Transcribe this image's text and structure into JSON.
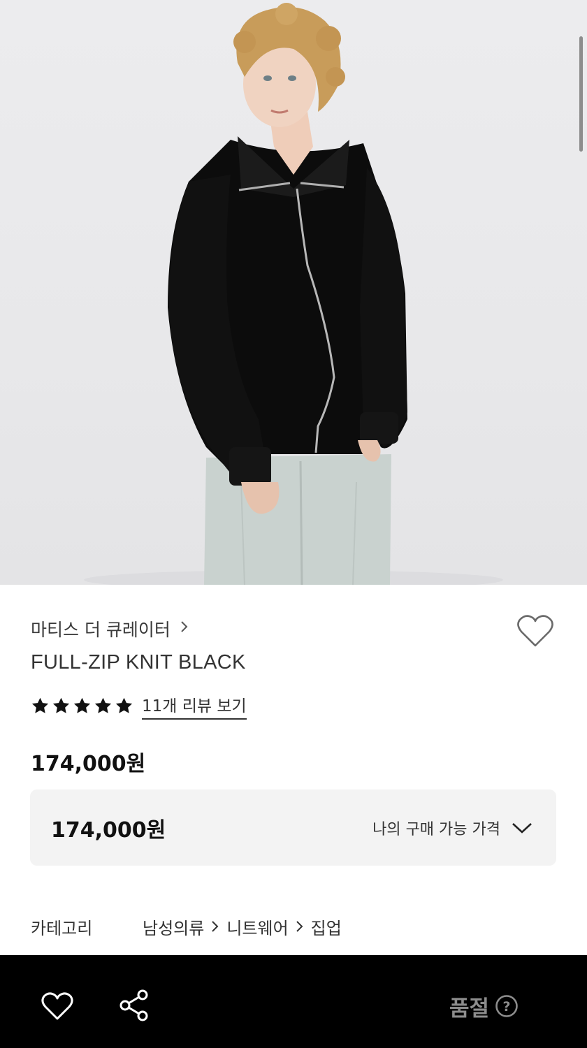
{
  "product": {
    "brand": "마티스 더 큐레이터",
    "name": "FULL-ZIP KNIT BLACK",
    "rating_stars": 5,
    "review_link": "11개 리뷰 보기",
    "price": "174,000원"
  },
  "price_box": {
    "price": "174,000원",
    "label": "나의 구매 가능 가격"
  },
  "category": {
    "label": "카테고리",
    "path": [
      "남성의류",
      "니트웨어",
      "집업"
    ]
  },
  "bottom_bar": {
    "sold_out": "품절",
    "help_icon": "?"
  },
  "icons": {
    "wishlist": "heart-outline-icon",
    "share": "share-icon",
    "chevron": "chevron-right-icon",
    "dropdown": "chevron-down-icon"
  },
  "colors": {
    "bottom_bar_bg": "#000000",
    "sold_out_text": "#8d8d8d",
    "price_box_bg": "#f3f3f3"
  }
}
